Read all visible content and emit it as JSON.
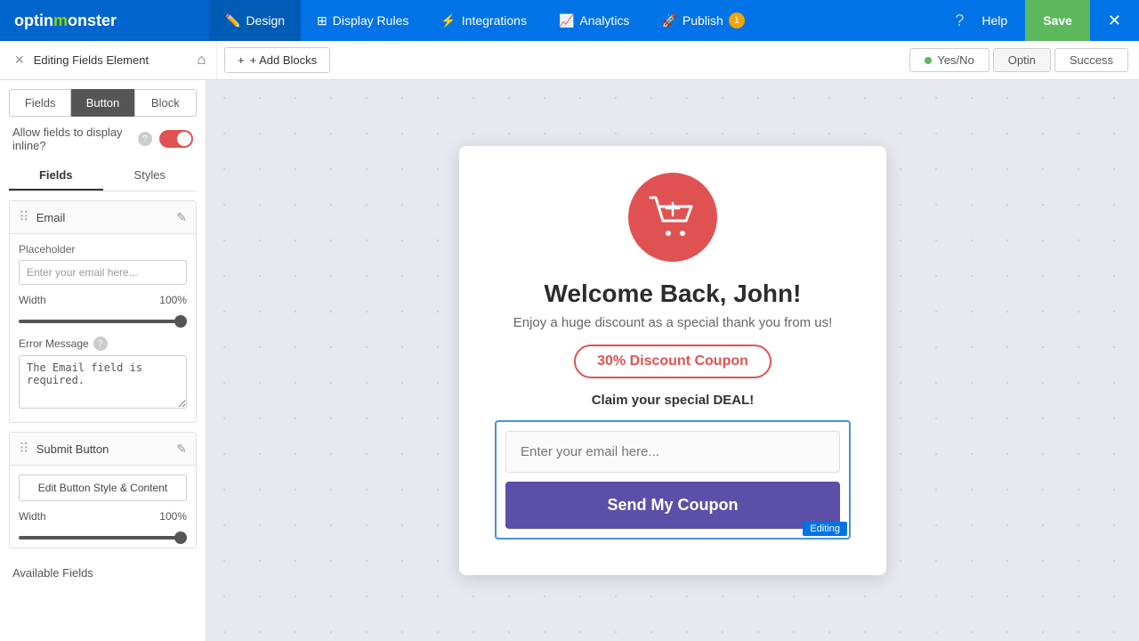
{
  "app": {
    "logo": "optinmonster",
    "logo_monster_char": "👾"
  },
  "topnav": {
    "items": [
      {
        "label": "Design",
        "icon": "✏️",
        "active": true
      },
      {
        "label": "Display Rules",
        "icon": "⊞"
      },
      {
        "label": "Integrations",
        "icon": "⚡"
      },
      {
        "label": "Analytics",
        "icon": "📈"
      },
      {
        "label": "Publish",
        "icon": "🚀"
      }
    ],
    "publish_badge": "1",
    "help_label": "Help",
    "save_label": "Save"
  },
  "subbar": {
    "editing_label": "Editing Fields Element",
    "add_blocks_label": "+ Add Blocks",
    "view_tabs": [
      "Yes/No",
      "Optin",
      "Success"
    ]
  },
  "left_panel": {
    "tabs": [
      "Fields",
      "Button",
      "Block"
    ],
    "inline_label": "Allow fields to display inline?",
    "sub_tabs": [
      "Fields",
      "Styles"
    ],
    "email_field": {
      "name": "Email",
      "placeholder_label": "Placeholder",
      "placeholder_value": "Enter your email here...",
      "width_label": "Width",
      "width_value": "100%",
      "error_label": "Error Message",
      "error_value": "The Email field is required."
    },
    "submit_button": {
      "name": "Submit Button",
      "edit_btn_label": "Edit Button Style & Content",
      "width_label": "Width",
      "width_value": "100%"
    },
    "available_fields_label": "Available Fields"
  },
  "popup": {
    "title": "Welcome Back, John!",
    "subtitle": "Enjoy a huge discount as a special thank you from us!",
    "coupon_badge": "30% Discount Coupon",
    "claim_text": "Claim your special DEAL!",
    "email_placeholder": "Enter your email here...",
    "submit_label": "Send My Coupon",
    "editing_badge": "Editing"
  }
}
